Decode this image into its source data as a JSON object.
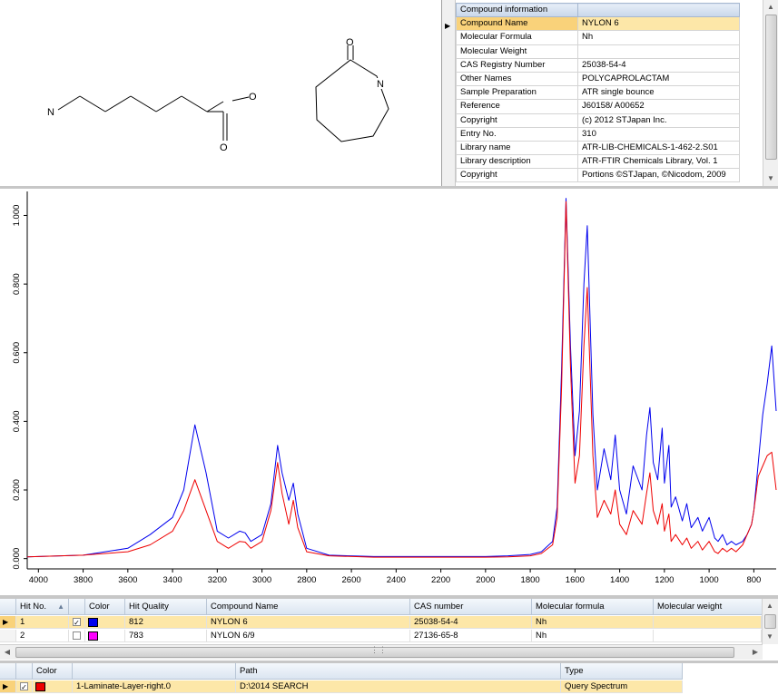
{
  "structures": {
    "amine_label": "N",
    "hydroxyl_label": "O",
    "carbonyl_label": "O",
    "ring_carbonyl_label": "O",
    "ring_nitrogen_label": "N"
  },
  "compound_info": {
    "header": "Compound information",
    "rows": [
      {
        "key": "Compound Name",
        "value": "NYLON 6"
      },
      {
        "key": "Molecular Formula",
        "value": "Nh"
      },
      {
        "key": "Molecular Weight",
        "value": ""
      },
      {
        "key": "CAS Registry Number",
        "value": "25038-54-4"
      },
      {
        "key": "Other Names",
        "value": "POLYCAPROLACTAM"
      },
      {
        "key": "Sample Preparation",
        "value": "ATR single bounce"
      },
      {
        "key": "Reference",
        "value": "J60158/ A00652"
      },
      {
        "key": "Copyright",
        "value": "(c) 2012 STJapan Inc."
      },
      {
        "key": "Entry No.",
        "value": "310"
      },
      {
        "key": "Library name",
        "value": "ATR-LIB-CHEMICALS-1-462-2.S01"
      },
      {
        "key": "Library description",
        "value": "ATR-FTIR Chemicals Library, Vol. 1"
      },
      {
        "key": "Copyright",
        "value": "Portions ©STJapan, ©Nicodom, 2009"
      }
    ]
  },
  "chart_data": {
    "type": "line",
    "title": "",
    "xlabel": "",
    "ylabel": "",
    "xlim": [
      4050,
      700
    ],
    "ylim": [
      -0.03,
      1.07
    ],
    "x_reversed": true,
    "grid": false,
    "legend": "none",
    "x_ticks": [
      4000,
      3800,
      3600,
      3400,
      3200,
      3000,
      2800,
      2600,
      2400,
      2200,
      2000,
      1800,
      1600,
      1400,
      1200,
      1000,
      800
    ],
    "y_ticks": [
      0.0,
      0.2,
      0.4,
      0.6,
      0.8,
      1.0
    ],
    "y_tick_labels": [
      "0.000",
      "0.200",
      "0.400",
      "0.600",
      "0.800",
      "1.000"
    ],
    "series": [
      {
        "color": "#0000ee",
        "x": [
          4050,
          3800,
          3600,
          3500,
          3400,
          3350,
          3300,
          3250,
          3200,
          3150,
          3100,
          3075,
          3050,
          3000,
          2960,
          2930,
          2910,
          2880,
          2860,
          2840,
          2800,
          2700,
          2500,
          2200,
          2000,
          1900,
          1800,
          1750,
          1700,
          1680,
          1660,
          1640,
          1620,
          1600,
          1580,
          1560,
          1545,
          1520,
          1500,
          1470,
          1440,
          1420,
          1400,
          1370,
          1340,
          1300,
          1280,
          1265,
          1250,
          1230,
          1210,
          1200,
          1180,
          1170,
          1150,
          1120,
          1100,
          1080,
          1050,
          1030,
          1000,
          975,
          960,
          940,
          920,
          900,
          880,
          850,
          830,
          810,
          800,
          780,
          760,
          740,
          720,
          700
        ],
        "y": [
          0.005,
          0.01,
          0.03,
          0.07,
          0.12,
          0.2,
          0.39,
          0.25,
          0.08,
          0.06,
          0.08,
          0.075,
          0.05,
          0.07,
          0.16,
          0.33,
          0.25,
          0.17,
          0.22,
          0.13,
          0.03,
          0.01,
          0.006,
          0.006,
          0.006,
          0.008,
          0.012,
          0.02,
          0.05,
          0.15,
          0.55,
          1.05,
          0.62,
          0.3,
          0.43,
          0.8,
          0.97,
          0.42,
          0.2,
          0.32,
          0.23,
          0.36,
          0.2,
          0.13,
          0.27,
          0.2,
          0.36,
          0.44,
          0.28,
          0.23,
          0.38,
          0.22,
          0.33,
          0.15,
          0.18,
          0.11,
          0.16,
          0.09,
          0.12,
          0.08,
          0.12,
          0.06,
          0.05,
          0.07,
          0.04,
          0.05,
          0.04,
          0.05,
          0.07,
          0.1,
          0.14,
          0.28,
          0.42,
          0.51,
          0.62,
          0.43
        ]
      },
      {
        "color": "#ee0000",
        "x": [
          4050,
          3800,
          3600,
          3500,
          3400,
          3350,
          3300,
          3250,
          3200,
          3150,
          3100,
          3075,
          3050,
          3000,
          2960,
          2930,
          2910,
          2880,
          2860,
          2840,
          2800,
          2700,
          2500,
          2200,
          2000,
          1900,
          1800,
          1750,
          1700,
          1680,
          1660,
          1640,
          1620,
          1600,
          1580,
          1560,
          1545,
          1520,
          1500,
          1470,
          1440,
          1420,
          1400,
          1370,
          1340,
          1300,
          1280,
          1265,
          1250,
          1230,
          1210,
          1200,
          1180,
          1170,
          1150,
          1120,
          1100,
          1080,
          1050,
          1030,
          1000,
          975,
          960,
          940,
          920,
          900,
          880,
          850,
          830,
          810,
          800,
          780,
          760,
          740,
          720,
          700
        ],
        "y": [
          0.005,
          0.01,
          0.02,
          0.04,
          0.08,
          0.14,
          0.23,
          0.14,
          0.05,
          0.03,
          0.05,
          0.048,
          0.03,
          0.05,
          0.14,
          0.28,
          0.19,
          0.1,
          0.17,
          0.09,
          0.02,
          0.008,
          0.004,
          0.004,
          0.004,
          0.005,
          0.008,
          0.015,
          0.04,
          0.12,
          0.5,
          1.04,
          0.56,
          0.22,
          0.3,
          0.62,
          0.79,
          0.3,
          0.12,
          0.17,
          0.13,
          0.2,
          0.1,
          0.07,
          0.14,
          0.1,
          0.19,
          0.25,
          0.14,
          0.1,
          0.16,
          0.08,
          0.13,
          0.05,
          0.07,
          0.04,
          0.06,
          0.03,
          0.05,
          0.025,
          0.05,
          0.02,
          0.015,
          0.03,
          0.02,
          0.03,
          0.02,
          0.04,
          0.07,
          0.1,
          0.14,
          0.24,
          0.27,
          0.3,
          0.31,
          0.2
        ]
      }
    ]
  },
  "hit_list": {
    "columns": [
      "Hit No.",
      "",
      "Color",
      "Hit Quality",
      "Compound Name",
      "CAS number",
      "Molecular formula",
      "Molecular weight"
    ],
    "rows": [
      {
        "no": "1",
        "checked": "✓",
        "color": "#0000ee",
        "quality": "812",
        "name": "NYLON 6",
        "cas": "25038-54-4",
        "formula": "Nh",
        "weight": ""
      },
      {
        "no": "2",
        "checked": "",
        "color": "#ff00ff",
        "quality": "783",
        "name": "NYLON 6/9",
        "cas": "27136-65-8",
        "formula": "Nh",
        "weight": ""
      }
    ]
  },
  "query_list": {
    "columns": [
      "",
      "Color",
      "",
      "Path",
      "Type"
    ],
    "rows": [
      {
        "checked": "✓",
        "color": "#ee0000",
        "name": "1-Laminate-Layer-right.0",
        "path": "D:\\2014 SEARCH",
        "type": "Query Spectrum"
      }
    ]
  }
}
